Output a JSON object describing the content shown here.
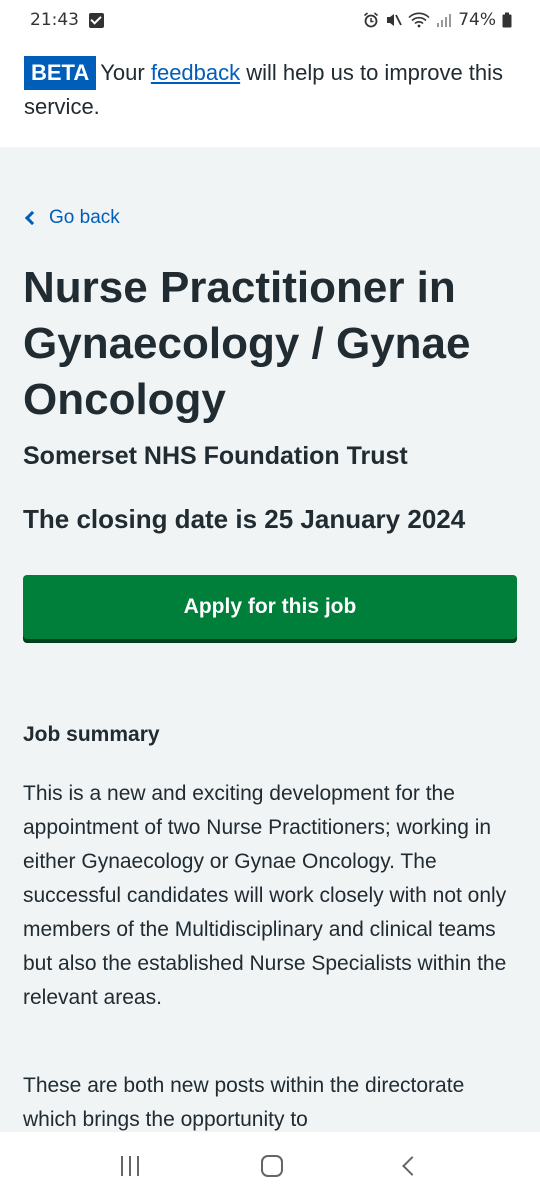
{
  "status_bar": {
    "time": "21:43",
    "battery": "74%",
    "icons": [
      "checkbox-notification-icon",
      "alarm-icon",
      "mute-icon",
      "wifi-icon",
      "signal-icon",
      "battery-icon"
    ]
  },
  "beta_banner": {
    "tag": "BETA",
    "text_before": "Your ",
    "link": "feedback",
    "text_after": " will help us to improve this service."
  },
  "nav": {
    "go_back": "Go back"
  },
  "job": {
    "title": "Nurse Practitioner in Gynaecology / Gynae Oncology",
    "employer": "Somerset NHS Foundation Trust",
    "closing_date": "The closing date is 25 January 2024",
    "apply_label": "Apply for this job"
  },
  "summary": {
    "heading": "Job summary",
    "paragraph1": "This is a new and exciting development for the appointment of two Nurse Practitioners; working in either Gynaecology or Gynae Oncology. The successful candidates will work closely with not only members of the Multidisciplinary and clinical teams but also the established Nurse Specialists within the relevant areas.",
    "paragraph2": "These are both new posts within the directorate which brings the opportunity to"
  },
  "colors": {
    "nhs_blue": "#005eb8",
    "nhs_green": "#007f3b",
    "text": "#212b32",
    "background": "#f0f4f5"
  }
}
